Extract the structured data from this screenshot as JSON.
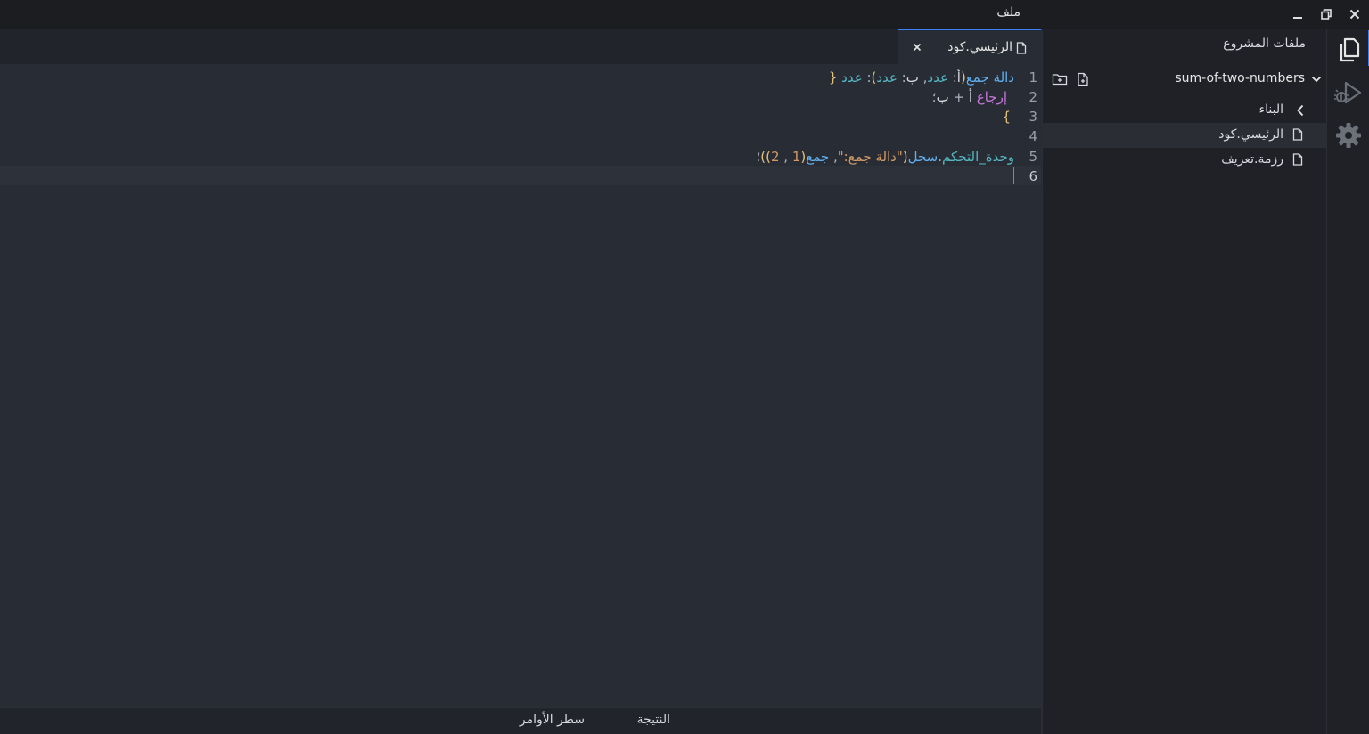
{
  "titlebar": {
    "menu_file": "ملف"
  },
  "sidebar": {
    "title": "ملفات المشروع",
    "project_name": "sum-of-two-numbers",
    "tree": [
      {
        "label": "البناء",
        "type": "folder"
      },
      {
        "label": "الرئيسي.كود",
        "type": "file",
        "selected": true
      },
      {
        "label": "رزمة.تعريف",
        "type": "file"
      }
    ]
  },
  "editor": {
    "tab_label": "الرئيسي.كود",
    "line_numbers": [
      "1",
      "2",
      "3",
      "4",
      "5",
      "6"
    ],
    "lines": {
      "l1": {
        "kw": "دالة",
        "fn": "جمع",
        "open": "(",
        "p1": "أ",
        "c1": ":",
        "t1": "عدد",
        "comma": ",",
        "p2": "ب",
        "c2": ":",
        "t2": "عدد",
        "close": ")",
        "c3": ":",
        "t3": "عدد",
        "brace": "{"
      },
      "l2": {
        "kw": "إرجاع",
        "a": "أ",
        "op": "+",
        "b": "ب",
        "semi": "؛"
      },
      "l3": {
        "brace": "}"
      },
      "l5": {
        "obj": "وحدة_التحكم",
        "dot": ".",
        "method": "سجل",
        "open": "(",
        "str": "\"دالة جمع:\"",
        "comma": ",",
        "fn": "جمع",
        "open2": "(",
        "n1": "1",
        "comma2": ",",
        "n2": "2",
        "close2": ")",
        "close": ")",
        "semi": "؛"
      }
    }
  },
  "panel": {
    "tabs": [
      "النتيجة",
      "سطر الأوامر"
    ]
  },
  "icons": {
    "close": "close-icon",
    "maximize": "maximize-icon",
    "minimize": "minimize-icon",
    "files": "files-icon",
    "run_debug": "run-debug-icon",
    "settings": "gear-icon"
  },
  "colors": {
    "accent": "#3b82f6"
  }
}
